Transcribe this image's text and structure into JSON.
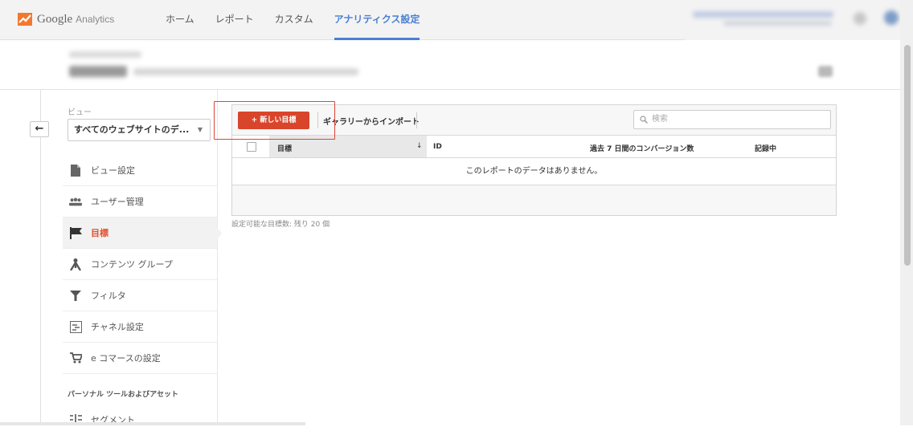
{
  "app": {
    "logo_google": "Google",
    "logo_analytics": "Analytics"
  },
  "nav": {
    "items": [
      {
        "label": "ホーム",
        "active": false
      },
      {
        "label": "レポート",
        "active": false
      },
      {
        "label": "カスタム",
        "active": false
      },
      {
        "label": "アナリティクス設定",
        "active": true
      }
    ]
  },
  "sidebar": {
    "back_icon": "←",
    "view_label": "ビュー",
    "view_selected": "すべてのウェブサイトのデ...",
    "items": [
      {
        "label": "ビュー設定",
        "icon": "document-icon",
        "active": false
      },
      {
        "label": "ユーザー管理",
        "icon": "users-icon",
        "active": false
      },
      {
        "label": "目標",
        "icon": "flag-icon",
        "active": true
      },
      {
        "label": "コンテンツ グループ",
        "icon": "content-group-icon",
        "active": false
      },
      {
        "label": "フィルタ",
        "icon": "filter-icon",
        "active": false
      },
      {
        "label": "チャネル設定",
        "icon": "channel-icon",
        "active": false
      },
      {
        "label": "e コマースの設定",
        "icon": "cart-icon",
        "active": false
      },
      {
        "label": "セグメント",
        "icon": "segment-icon",
        "active": false
      }
    ],
    "section_personal": "パーソナル ツールおよびアセット"
  },
  "toolbar": {
    "new_goal_label": "+ 新しい目標",
    "import_label": "ギャラリーからインポート",
    "search_placeholder": "検索"
  },
  "table": {
    "columns": [
      "目標",
      "ID",
      "過去 7 日間のコンバージョン数",
      "記録中"
    ],
    "sort_indicator": "↓",
    "empty_message": "このレポートのデータはありません。"
  },
  "remaining_text": "設定可能な目標数: 残り 20 個",
  "colors": {
    "accent_red": "#d9452b",
    "nav_active": "#4a7fd4",
    "active_item": "#e2502c"
  }
}
